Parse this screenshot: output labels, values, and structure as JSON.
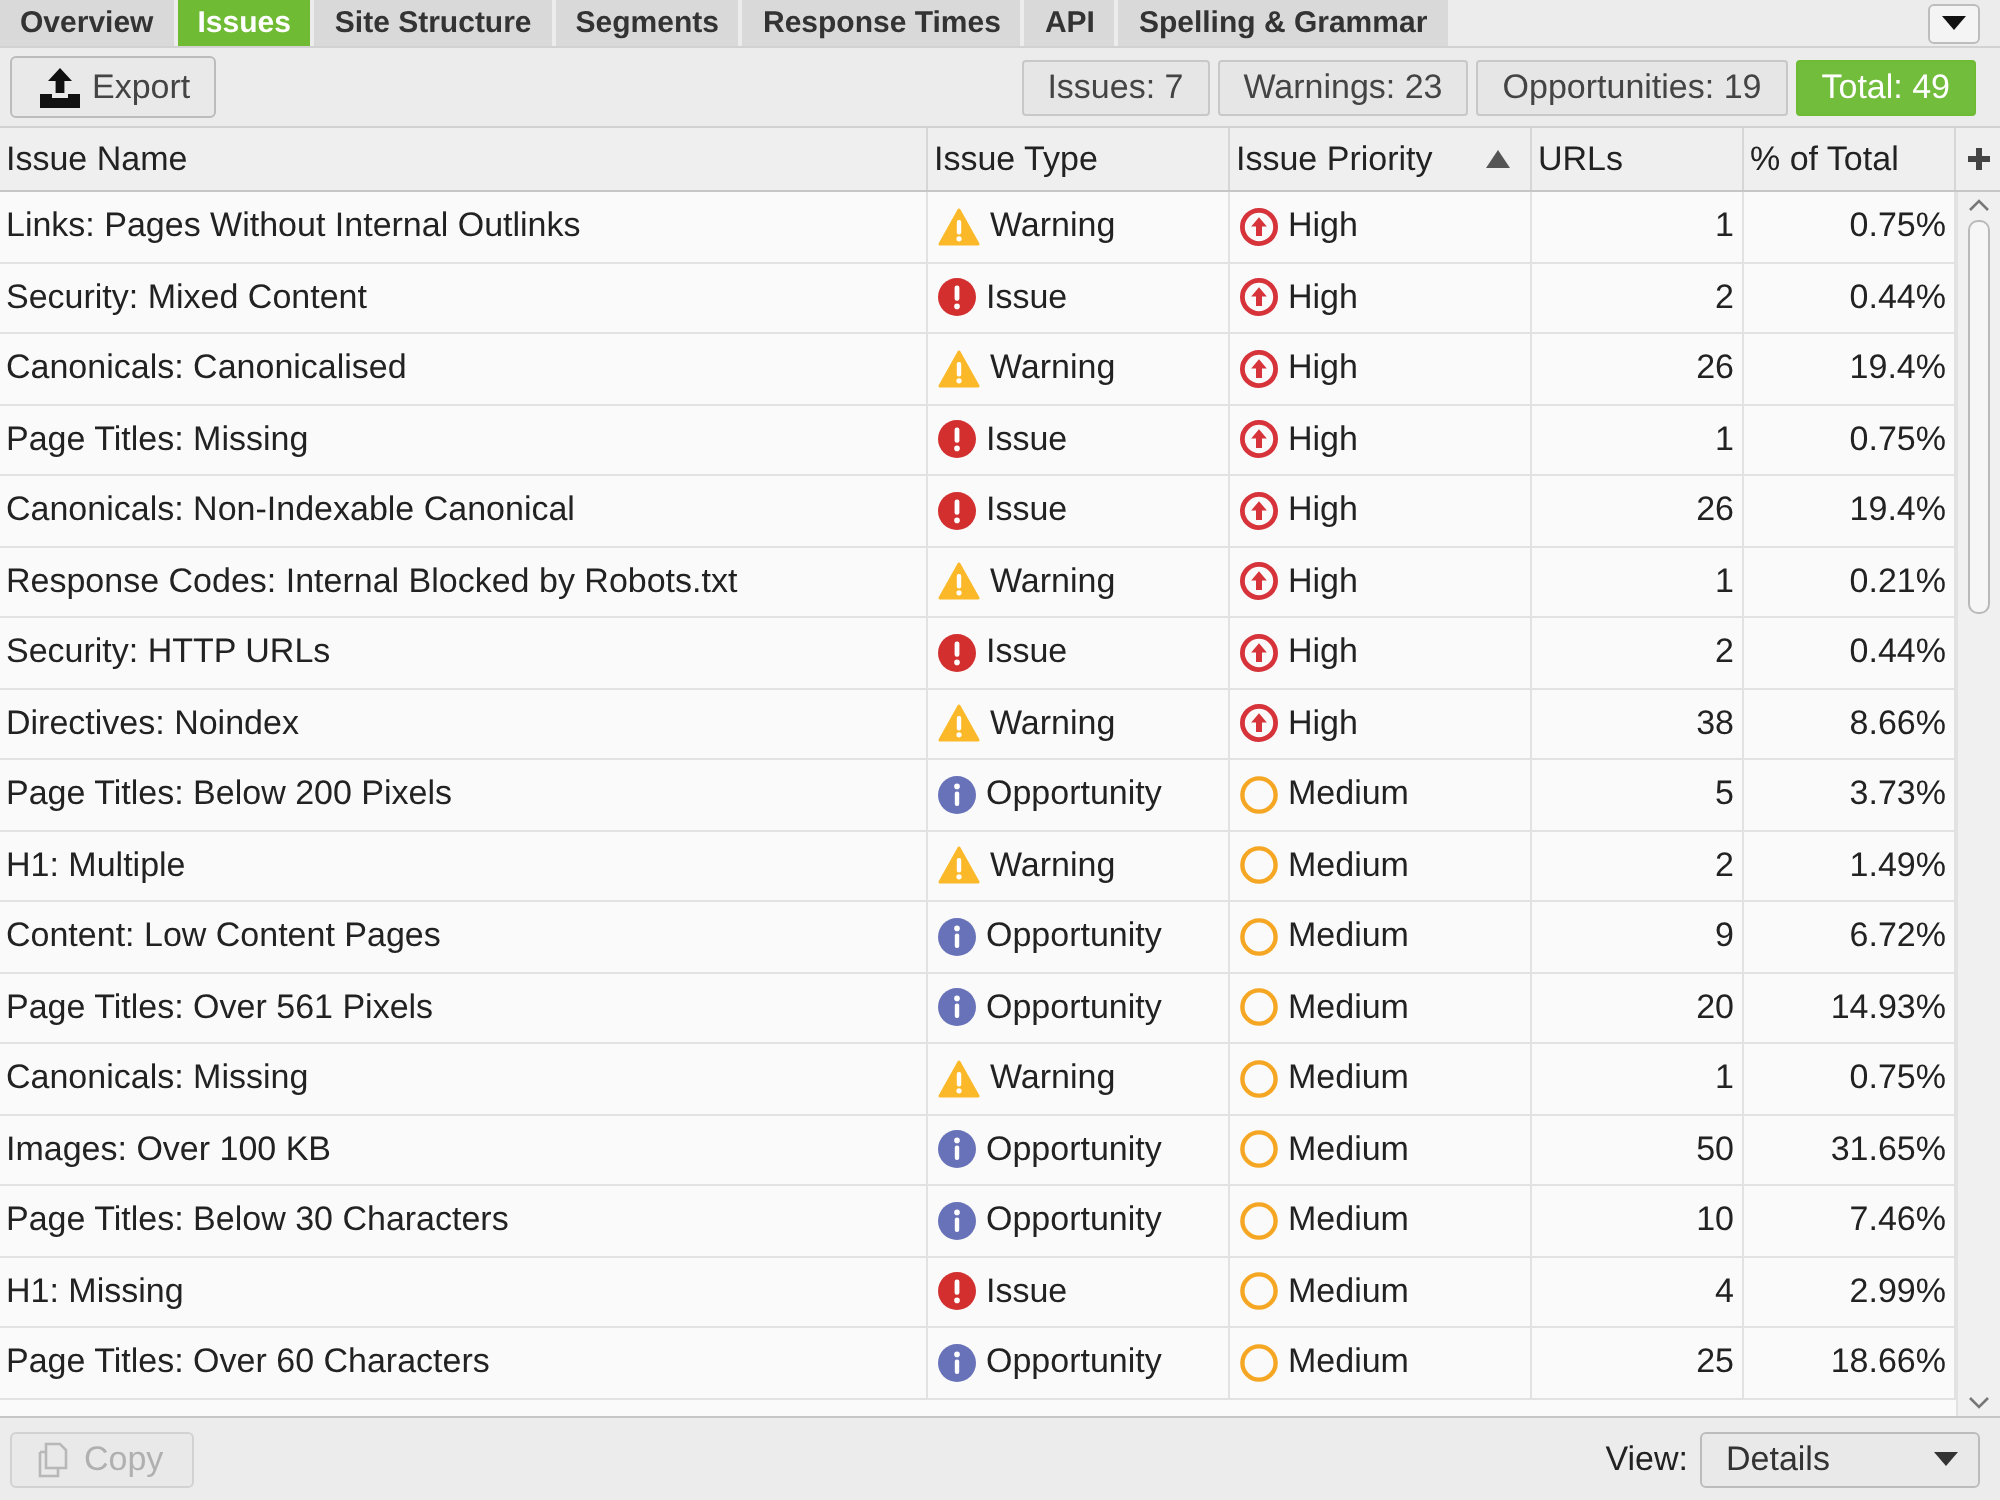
{
  "tabs": [
    {
      "label": "Overview",
      "selected": false
    },
    {
      "label": "Issues",
      "selected": true
    },
    {
      "label": "Site Structure",
      "selected": false
    },
    {
      "label": "Segments",
      "selected": false
    },
    {
      "label": "Response Times",
      "selected": false
    },
    {
      "label": "API",
      "selected": false
    },
    {
      "label": "Spelling & Grammar",
      "selected": false
    }
  ],
  "toolbar": {
    "export_button": "Export",
    "summary": [
      {
        "label": "Issues: 7",
        "selected": false
      },
      {
        "label": "Warnings: 23",
        "selected": false
      },
      {
        "label": "Opportunities: 19",
        "selected": false
      },
      {
        "label": "Total: 49",
        "selected": true
      }
    ]
  },
  "table": {
    "columns": [
      {
        "label": "Issue Name",
        "sorted": false
      },
      {
        "label": "Issue Type",
        "sorted": false
      },
      {
        "label": "Issue Priority",
        "sorted": true
      },
      {
        "label": "URLs",
        "sorted": false
      },
      {
        "label": "% of Total",
        "sorted": false
      }
    ],
    "rows": [
      {
        "name": "Links: Pages Without Internal Outlinks",
        "type": {
          "kind": "warning",
          "text": "Warning"
        },
        "priority": {
          "kind": "high",
          "text": "High"
        },
        "urls": "1",
        "percent": "0.75%",
        "selected": false
      },
      {
        "name": "Security: Mixed Content",
        "type": {
          "kind": "issue",
          "text": "Issue"
        },
        "priority": {
          "kind": "high",
          "text": "High"
        },
        "urls": "2",
        "percent": "0.44%",
        "selected": false
      },
      {
        "name": "Canonicals: Canonicalised",
        "type": {
          "kind": "warning",
          "text": "Warning"
        },
        "priority": {
          "kind": "high",
          "text": "High"
        },
        "urls": "26",
        "percent": "19.4%",
        "selected": false
      },
      {
        "name": "Page Titles: Missing",
        "type": {
          "kind": "issue",
          "text": "Issue"
        },
        "priority": {
          "kind": "high",
          "text": "High"
        },
        "urls": "1",
        "percent": "0.75%",
        "selected": false
      },
      {
        "name": "Canonicals: Non-Indexable Canonical",
        "type": {
          "kind": "issue",
          "text": "Issue"
        },
        "priority": {
          "kind": "high",
          "text": "High"
        },
        "urls": "26",
        "percent": "19.4%",
        "selected": false
      },
      {
        "name": "Response Codes: Internal Blocked by Robots.txt",
        "type": {
          "kind": "warning",
          "text": "Warning"
        },
        "priority": {
          "kind": "high",
          "text": "High"
        },
        "urls": "1",
        "percent": "0.21%",
        "selected": false
      },
      {
        "name": "Security: HTTP URLs",
        "type": {
          "kind": "issue",
          "text": "Issue"
        },
        "priority": {
          "kind": "high",
          "text": "High"
        },
        "urls": "2",
        "percent": "0.44%",
        "selected": false
      },
      {
        "name": "Directives: Noindex",
        "type": {
          "kind": "warning",
          "text": "Warning"
        },
        "priority": {
          "kind": "high",
          "text": "High"
        },
        "urls": "38",
        "percent": "8.66%",
        "selected": false
      },
      {
        "name": "Page Titles: Below 200 Pixels",
        "type": {
          "kind": "opportunity",
          "text": "Opportunity"
        },
        "priority": {
          "kind": "medium",
          "text": "Medium"
        },
        "urls": "5",
        "percent": "3.73%",
        "selected": false
      },
      {
        "name": "H1: Multiple",
        "type": {
          "kind": "warning",
          "text": "Warning"
        },
        "priority": {
          "kind": "medium",
          "text": "Medium"
        },
        "urls": "2",
        "percent": "1.49%",
        "selected": false
      },
      {
        "name": "Content: Low Content Pages",
        "type": {
          "kind": "opportunity",
          "text": "Opportunity"
        },
        "priority": {
          "kind": "medium",
          "text": "Medium"
        },
        "urls": "9",
        "percent": "6.72%",
        "selected": false
      },
      {
        "name": "Page Titles: Over 561 Pixels",
        "type": {
          "kind": "opportunity",
          "text": "Opportunity"
        },
        "priority": {
          "kind": "medium",
          "text": "Medium"
        },
        "urls": "20",
        "percent": "14.93%",
        "selected": false
      },
      {
        "name": "Canonicals: Missing",
        "type": {
          "kind": "warning",
          "text": "Warning"
        },
        "priority": {
          "kind": "medium",
          "text": "Medium"
        },
        "urls": "1",
        "percent": "0.75%",
        "selected": false
      },
      {
        "name": "Images: Over 100 KB",
        "type": {
          "kind": "opportunity",
          "text": "Opportunity"
        },
        "priority": {
          "kind": "medium",
          "text": "Medium"
        },
        "urls": "50",
        "percent": "31.65%",
        "selected": false
      },
      {
        "name": "Page Titles: Below 30 Characters",
        "type": {
          "kind": "opportunity",
          "text": "Opportunity"
        },
        "priority": {
          "kind": "medium",
          "text": "Medium"
        },
        "urls": "10",
        "percent": "7.46%",
        "selected": false
      },
      {
        "name": "H1: Missing",
        "type": {
          "kind": "issue",
          "text": "Issue"
        },
        "priority": {
          "kind": "medium",
          "text": "Medium"
        },
        "urls": "4",
        "percent": "2.99%",
        "selected": false
      },
      {
        "name": "Page Titles: Over 60 Characters",
        "type": {
          "kind": "opportunity",
          "text": "Opportunity"
        },
        "priority": {
          "kind": "medium",
          "text": "Medium"
        },
        "urls": "25",
        "percent": "18.66%",
        "selected": false
      }
    ]
  },
  "bottom_bar": {
    "copy_button": {
      "label": "Copy",
      "disabled": true
    },
    "view": {
      "label": "View:",
      "value": "Details"
    }
  }
}
